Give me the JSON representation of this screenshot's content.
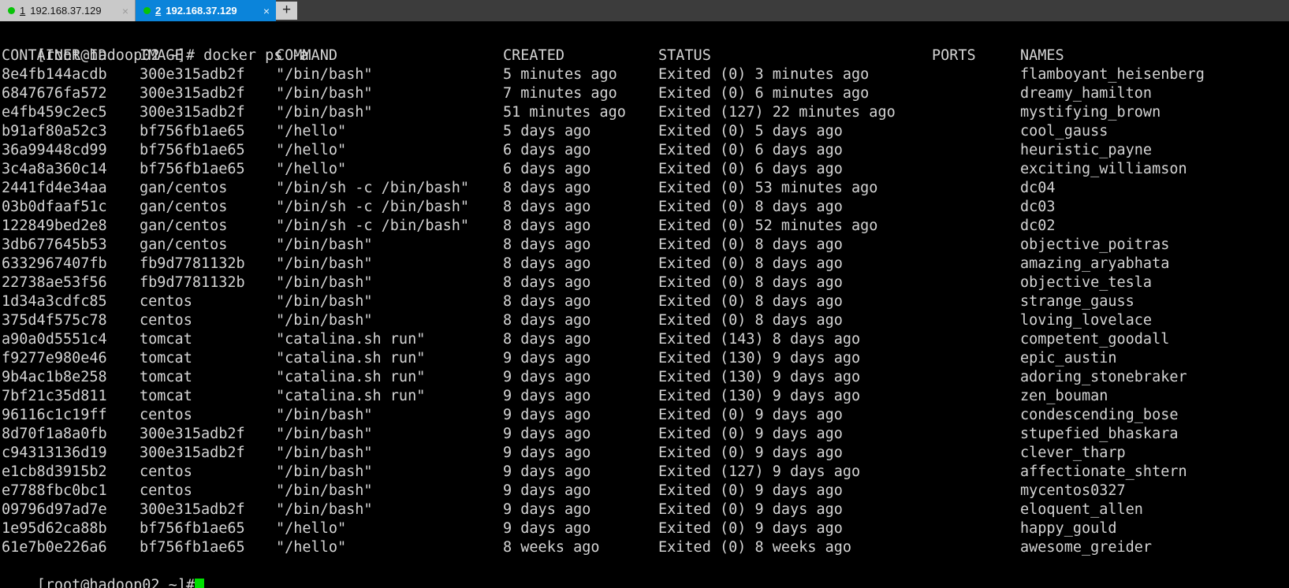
{
  "tabs": [
    {
      "number": "1",
      "title": "192.168.37.129",
      "close_label": "×",
      "active": false
    },
    {
      "number": "2",
      "title": "192.168.37.129",
      "close_label": "×",
      "active": true
    }
  ],
  "new_tab_label": "+",
  "terminal": {
    "prompt": "[root@hadoop02 ~]#",
    "command": "docker ps -a",
    "prompt_line": "[root@hadoop02 ~]# docker ps -a",
    "trailing_prompt": "[root@hadoop02 ~]#",
    "colors": {
      "background": "#000000",
      "foreground": "#d4d4d4",
      "cursor": "#00e000",
      "tab_active": "#0b84da",
      "tab_inactive": "#c9c9c9",
      "tab_dot": "#07c307"
    },
    "headers": {
      "container_id": "CONTAINER ID",
      "image": "IMAGE",
      "command": "COMMAND",
      "created": "CREATED",
      "status": "STATUS",
      "ports": "PORTS",
      "names": "NAMES"
    },
    "rows": [
      {
        "container_id": "8e4fb144acdb",
        "image": "300e315adb2f",
        "command": "\"/bin/bash\"",
        "created": "5 minutes ago",
        "status": "Exited (0) 3 minutes ago",
        "ports": "",
        "names": "flamboyant_heisenberg"
      },
      {
        "container_id": "6847676fa572",
        "image": "300e315adb2f",
        "command": "\"/bin/bash\"",
        "created": "7 minutes ago",
        "status": "Exited (0) 6 minutes ago",
        "ports": "",
        "names": "dreamy_hamilton"
      },
      {
        "container_id": "e4fb459c2ec5",
        "image": "300e315adb2f",
        "command": "\"/bin/bash\"",
        "created": "51 minutes ago",
        "status": "Exited (127) 22 minutes ago",
        "ports": "",
        "names": "mystifying_brown"
      },
      {
        "container_id": "b91af80a52c3",
        "image": "bf756fb1ae65",
        "command": "\"/hello\"",
        "created": "5 days ago",
        "status": "Exited (0) 5 days ago",
        "ports": "",
        "names": "cool_gauss"
      },
      {
        "container_id": "36a99448cd99",
        "image": "bf756fb1ae65",
        "command": "\"/hello\"",
        "created": "6 days ago",
        "status": "Exited (0) 6 days ago",
        "ports": "",
        "names": "heuristic_payne"
      },
      {
        "container_id": "3c4a8a360c14",
        "image": "bf756fb1ae65",
        "command": "\"/hello\"",
        "created": "6 days ago",
        "status": "Exited (0) 6 days ago",
        "ports": "",
        "names": "exciting_williamson"
      },
      {
        "container_id": "2441fd4e34aa",
        "image": "gan/centos",
        "command": "\"/bin/sh -c /bin/bash\"",
        "created": "8 days ago",
        "status": "Exited (0) 53 minutes ago",
        "ports": "",
        "names": "dc04"
      },
      {
        "container_id": "03b0dfaaf51c",
        "image": "gan/centos",
        "command": "\"/bin/sh -c /bin/bash\"",
        "created": "8 days ago",
        "status": "Exited (0) 8 days ago",
        "ports": "",
        "names": "dc03"
      },
      {
        "container_id": "122849bed2e8",
        "image": "gan/centos",
        "command": "\"/bin/sh -c /bin/bash\"",
        "created": "8 days ago",
        "status": "Exited (0) 52 minutes ago",
        "ports": "",
        "names": "dc02"
      },
      {
        "container_id": "3db677645b53",
        "image": "gan/centos",
        "command": "\"/bin/bash\"",
        "created": "8 days ago",
        "status": "Exited (0) 8 days ago",
        "ports": "",
        "names": "objective_poitras"
      },
      {
        "container_id": "6332967407fb",
        "image": "fb9d7781132b",
        "command": "\"/bin/bash\"",
        "created": "8 days ago",
        "status": "Exited (0) 8 days ago",
        "ports": "",
        "names": "amazing_aryabhata"
      },
      {
        "container_id": "22738ae53f56",
        "image": "fb9d7781132b",
        "command": "\"/bin/bash\"",
        "created": "8 days ago",
        "status": "Exited (0) 8 days ago",
        "ports": "",
        "names": "objective_tesla"
      },
      {
        "container_id": "1d34a3cdfc85",
        "image": "centos",
        "command": "\"/bin/bash\"",
        "created": "8 days ago",
        "status": "Exited (0) 8 days ago",
        "ports": "",
        "names": "strange_gauss"
      },
      {
        "container_id": "375d4f575c78",
        "image": "centos",
        "command": "\"/bin/bash\"",
        "created": "8 days ago",
        "status": "Exited (0) 8 days ago",
        "ports": "",
        "names": "loving_lovelace"
      },
      {
        "container_id": "a90a0d5551c4",
        "image": "tomcat",
        "command": "\"catalina.sh run\"",
        "created": "8 days ago",
        "status": "Exited (143) 8 days ago",
        "ports": "",
        "names": "competent_goodall"
      },
      {
        "container_id": "f9277e980e46",
        "image": "tomcat",
        "command": "\"catalina.sh run\"",
        "created": "9 days ago",
        "status": "Exited (130) 9 days ago",
        "ports": "",
        "names": "epic_austin"
      },
      {
        "container_id": "9b4ac1b8e258",
        "image": "tomcat",
        "command": "\"catalina.sh run\"",
        "created": "9 days ago",
        "status": "Exited (130) 9 days ago",
        "ports": "",
        "names": "adoring_stonebraker"
      },
      {
        "container_id": "7bf21c35d811",
        "image": "tomcat",
        "command": "\"catalina.sh run\"",
        "created": "9 days ago",
        "status": "Exited (130) 9 days ago",
        "ports": "",
        "names": "zen_bouman"
      },
      {
        "container_id": "96116c1c19ff",
        "image": "centos",
        "command": "\"/bin/bash\"",
        "created": "9 days ago",
        "status": "Exited (0) 9 days ago",
        "ports": "",
        "names": "condescending_bose"
      },
      {
        "container_id": "8d70f1a8a0fb",
        "image": "300e315adb2f",
        "command": "\"/bin/bash\"",
        "created": "9 days ago",
        "status": "Exited (0) 9 days ago",
        "ports": "",
        "names": "stupefied_bhaskara"
      },
      {
        "container_id": "c94313136d19",
        "image": "300e315adb2f",
        "command": "\"/bin/bash\"",
        "created": "9 days ago",
        "status": "Exited (0) 9 days ago",
        "ports": "",
        "names": "clever_tharp"
      },
      {
        "container_id": "e1cb8d3915b2",
        "image": "centos",
        "command": "\"/bin/bash\"",
        "created": "9 days ago",
        "status": "Exited (127) 9 days ago",
        "ports": "",
        "names": "affectionate_shtern"
      },
      {
        "container_id": "e7788fbc0bc1",
        "image": "centos",
        "command": "\"/bin/bash\"",
        "created": "9 days ago",
        "status": "Exited (0) 9 days ago",
        "ports": "",
        "names": "mycentos0327"
      },
      {
        "container_id": "09796d97ad7e",
        "image": "300e315adb2f",
        "command": "\"/bin/bash\"",
        "created": "9 days ago",
        "status": "Exited (0) 9 days ago",
        "ports": "",
        "names": "eloquent_allen"
      },
      {
        "container_id": "1e95d62ca88b",
        "image": "bf756fb1ae65",
        "command": "\"/hello\"",
        "created": "9 days ago",
        "status": "Exited (0) 9 days ago",
        "ports": "",
        "names": "happy_gould"
      },
      {
        "container_id": "61e7b0e226a6",
        "image": "bf756fb1ae65",
        "command": "\"/hello\"",
        "created": "8 weeks ago",
        "status": "Exited (0) 8 weeks ago",
        "ports": "",
        "names": "awesome_greider"
      }
    ]
  }
}
